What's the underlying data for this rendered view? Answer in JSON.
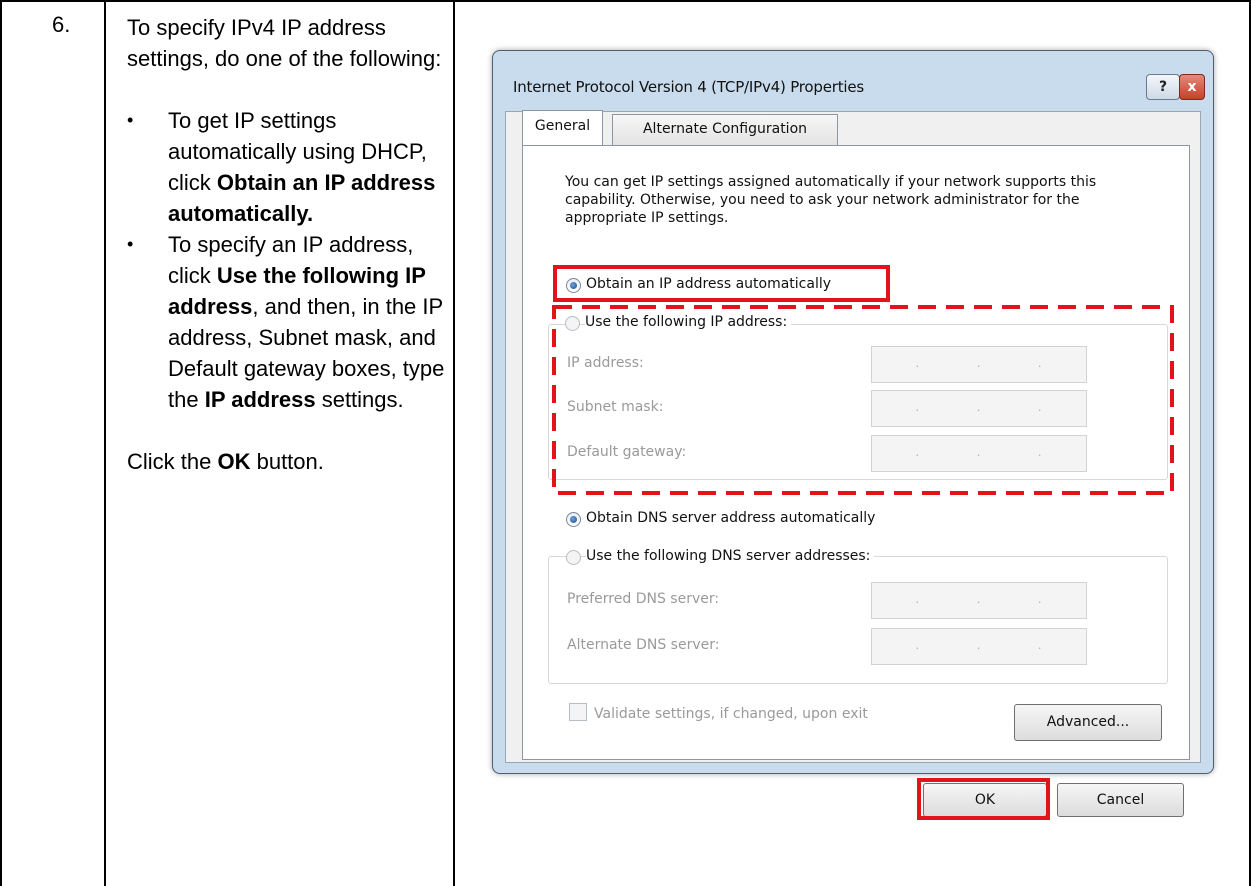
{
  "step": {
    "number": "6.",
    "intro": "To specify IPv4 IP address settings, do one of the following:",
    "bullet1": {
      "pre": "To get IP settings automatically using DHCP, click ",
      "bold": "Obtain an IP address automatically."
    },
    "bullet2": {
      "pre": "To specify an IP address, click ",
      "bold1": "Use the following IP address",
      "mid": ", and then, in the IP address, Subnet mask, and Default gateway boxes, type the ",
      "bold2": "IP address",
      "post": " settings."
    },
    "final": {
      "pre": "Click the ",
      "bold": "OK",
      "post": " button."
    }
  },
  "dialog": {
    "title": "Internet Protocol Version 4 (TCP/IPv4) Properties",
    "help_label": "?",
    "close_label": "x",
    "tabs": [
      "General",
      "Alternate Configuration"
    ],
    "description": "You can get IP settings assigned automatically if your network supports this capability. Otherwise, you need to ask your network administrator for the appropriate IP settings.",
    "ip_auto": "Obtain an IP address automatically",
    "ip_manual": "Use the following IP address:",
    "ip_fields": [
      "IP address:",
      "Subnet mask:",
      "Default gateway:"
    ],
    "dns_auto": "Obtain DNS server address automatically",
    "dns_manual": "Use the following DNS server addresses:",
    "dns_fields": [
      "Preferred DNS server:",
      "Alternate DNS server:"
    ],
    "ip_placeholder": ". . .",
    "validate_label": "Validate settings, if changed, upon exit",
    "advanced_button": "Advanced...",
    "ok_button": "OK",
    "cancel_button": "Cancel"
  },
  "colors": {
    "highlight": "#e3131b"
  }
}
